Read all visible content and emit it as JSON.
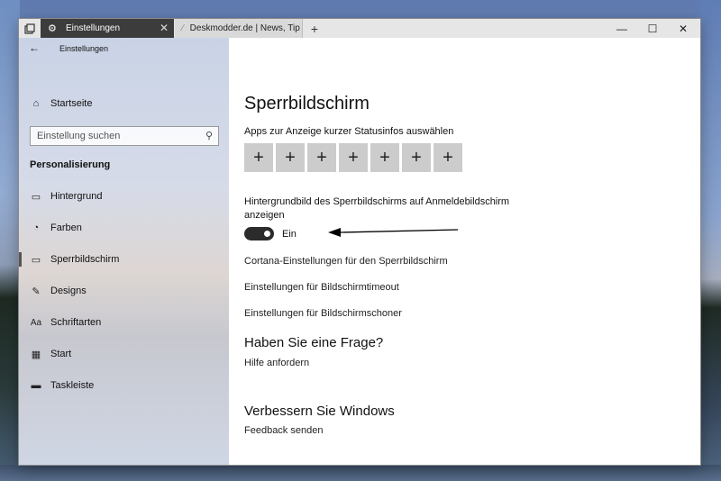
{
  "browser": {
    "active_tab": "Einstellungen",
    "inactive_tab": "Deskmodder.de | News, Tip",
    "new_tab": "+",
    "close_tab": "✕",
    "minimize": "—",
    "maximize": "☐",
    "close": "✕"
  },
  "sidebar": {
    "back": "←",
    "title": "Einstellungen",
    "home": "Startseite",
    "search_placeholder": "Einstellung suchen",
    "section": "Personalisierung",
    "items": [
      {
        "label": "Hintergrund",
        "icon": "picture-icon"
      },
      {
        "label": "Farben",
        "icon": "palette-icon"
      },
      {
        "label": "Sperrbildschirm",
        "icon": "lockscreen-icon",
        "selected": true
      },
      {
        "label": "Designs",
        "icon": "brush-icon"
      },
      {
        "label": "Schriftarten",
        "icon": "font-icon"
      },
      {
        "label": "Start",
        "icon": "start-icon"
      },
      {
        "label": "Taskleiste",
        "icon": "taskbar-icon"
      }
    ]
  },
  "main": {
    "title": "Sperrbildschirm",
    "apps_label": "Apps zur Anzeige kurzer Statusinfos auswählen",
    "plus": "+",
    "bg_label_line1": "Hintergrundbild des Sperrbildschirms auf Anmeldebildschirm",
    "bg_label_line2": "anzeigen",
    "toggle_state": "Ein",
    "link_cortana": "Cortana-Einstellungen für den Sperrbildschirm",
    "link_timeout": "Einstellungen für Bildschirmtimeout",
    "link_saver": "Einstellungen für Bildschirmschoner",
    "question_heading": "Haben Sie eine Frage?",
    "help_link": "Hilfe anfordern",
    "improve_heading": "Verbessern Sie Windows",
    "feedback_link": "Feedback senden"
  }
}
